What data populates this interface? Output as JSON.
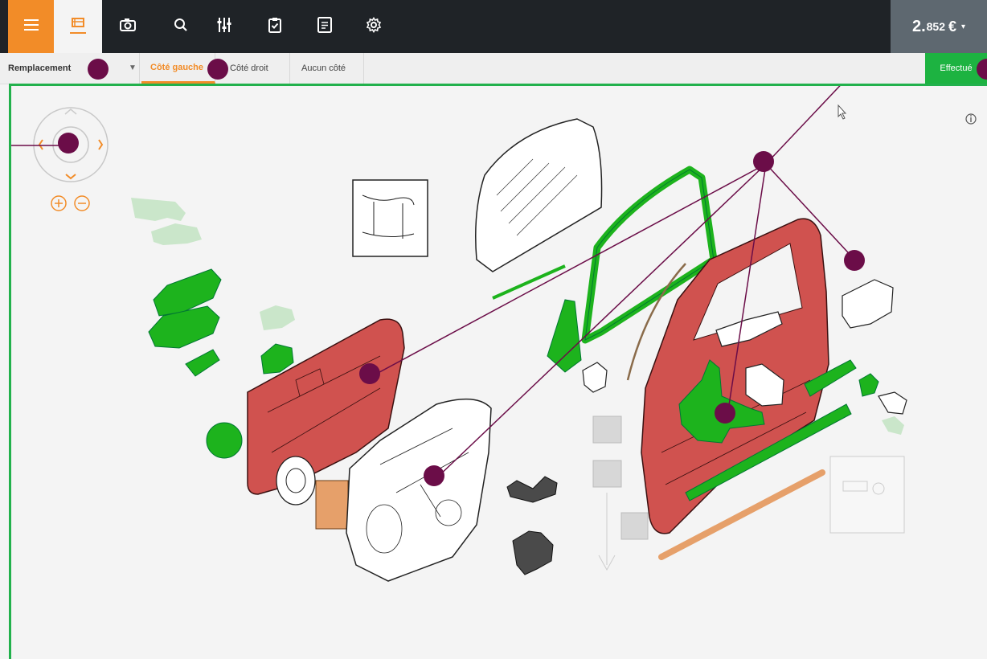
{
  "topbar": {
    "icons": [
      "menu-icon",
      "car-parts-icon",
      "camera-icon",
      "search-icon",
      "sliders-icon",
      "clipboard-check-icon",
      "invoice-icon",
      "settings-icon"
    ],
    "price": {
      "main": "2.",
      "decimals": "852",
      "currency": "€"
    }
  },
  "subbar": {
    "mode": "Remplacement",
    "tabs": [
      "Côté gauche",
      "Côté droit",
      "Aucun côté"
    ],
    "active_tab": "Côté gauche",
    "done_label": "Effectué"
  },
  "colors": {
    "accent": "#f28c28",
    "topbar": "#1f2327",
    "green": "#22b14c",
    "red_part": "#d0524f",
    "annotation": "#6b0d48"
  }
}
